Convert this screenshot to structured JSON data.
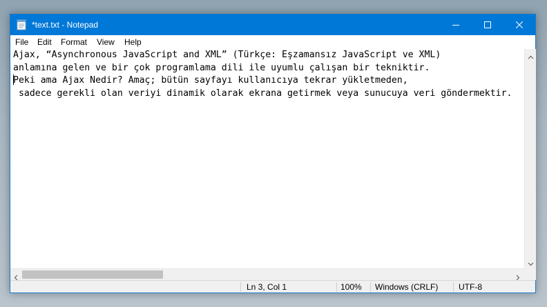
{
  "window": {
    "title": "*text.txt - Notepad",
    "accent_color": "#0078d7"
  },
  "titlebar": {
    "app_icon": "notepad-icon",
    "minimize_icon": "minimize-icon",
    "maximize_icon": "maximize-icon",
    "close_icon": "close-icon"
  },
  "menu": {
    "items": [
      {
        "label": "File"
      },
      {
        "label": "Edit"
      },
      {
        "label": "Format"
      },
      {
        "label": "View"
      },
      {
        "label": "Help"
      }
    ]
  },
  "editor": {
    "lines": [
      "Ajax, “Asynchronous JavaScript and XML” (Türkçe: Eşzamansız JavaScript ve XML)",
      "anlamına gelen ve bir çok programlama dili ile uyumlu çalışan bir tekniktir.",
      "Peki ama Ajax Nedir? Amaç; bütün sayfayı kullanıcıya tekrar yükletmeden,",
      " sadece gerekli olan veriyi dinamik olarak ekrana getirmek veya sunucuya veri göndermektir."
    ]
  },
  "status": {
    "position": "Ln 3, Col 1",
    "zoom": "100%",
    "line_ending": "Windows (CRLF)",
    "encoding": "UTF-8"
  }
}
